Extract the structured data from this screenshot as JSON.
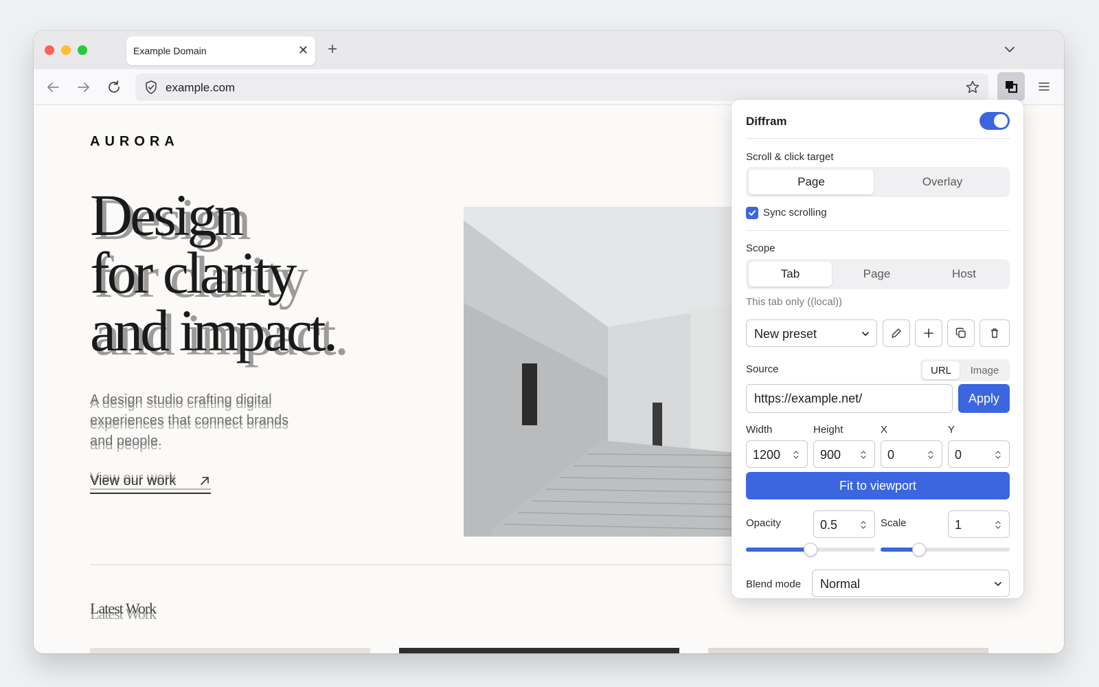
{
  "browser": {
    "tab_title": "Example Domain",
    "url": "example.com"
  },
  "site": {
    "brand": "AURORA",
    "hero_line1": "Design",
    "hero_line2": "for clarity",
    "hero_line3": "and impact.",
    "hero_sub": "A design studio crafting digital experiences that connect brands and people.",
    "cta": "View our work",
    "section_title": "Latest Work"
  },
  "panel": {
    "title": "Diffram",
    "enabled": true,
    "target_label": "Scroll & click target",
    "target_options": [
      "Page",
      "Overlay"
    ],
    "target_selected": "Page",
    "sync_label": "Sync scrolling",
    "sync_checked": true,
    "scope_label": "Scope",
    "scope_options": [
      "Tab",
      "Page",
      "Host"
    ],
    "scope_selected": "Tab",
    "scope_hint": "This tab only ((local))",
    "preset_value": "New preset",
    "source_label": "Source",
    "source_modes": [
      "URL",
      "Image"
    ],
    "source_mode_selected": "URL",
    "source_url": "https://example.net/",
    "apply_label": "Apply",
    "width_label": "Width",
    "width_value": "1200",
    "height_label": "Height",
    "height_value": "900",
    "x_label": "X",
    "x_value": "0",
    "y_label": "Y",
    "y_value": "0",
    "fit_label": "Fit to viewport",
    "opacity_label": "Opacity",
    "opacity_value": "0.5",
    "scale_label": "Scale",
    "scale_value": "1",
    "blend_label": "Blend mode",
    "blend_value": "Normal"
  },
  "colors": {
    "accent": "#3b66e0",
    "traffic_red": "#ff5f57",
    "traffic_yellow": "#febc2e",
    "traffic_green": "#28c840"
  }
}
